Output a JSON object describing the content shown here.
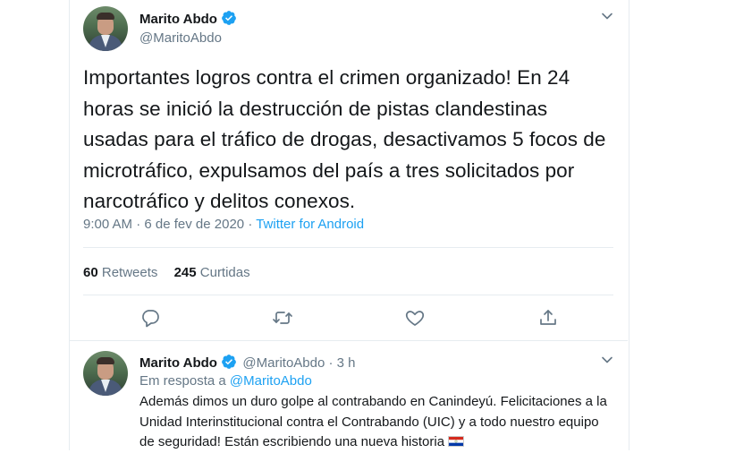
{
  "tweet": {
    "author_name": "Marito Abdo",
    "author_handle": "@MaritoAbdo",
    "text": "Importantes logros contra el crimen organizado! En 24 horas se inició la destrucción de pistas clandestinas usadas para el tráfico de drogas, desactivamos 5 focos de microtráfico, expulsamos del país a tres solicitados por narcotráfico y delitos conexos.",
    "time": "9:00 AM",
    "date": "6 de fev de 2020",
    "separator": " · ",
    "source": "Twitter for Android",
    "retweets_count": "60",
    "retweets_label": "Retweets",
    "likes_count": "245",
    "likes_label": "Curtidas"
  },
  "reply": {
    "author_name": "Marito Abdo",
    "author_handle": "@MaritoAbdo",
    "time_ago": "3 h",
    "in_reply_label": "Em resposta a",
    "in_reply_mention": "@MaritoAbdo",
    "text": "Además dimos un duro golpe al contrabando en Canindeyú. Felicitaciones a la Unidad Interinstitucional contra el Contrabando (UIC) y a todo nuestro equipo de seguridad! Están escribiendo una nueva historia"
  },
  "icons": {
    "verified": "verified-badge-icon",
    "caret": "chevron-down-icon",
    "reply": "reply-icon",
    "retweet": "retweet-icon",
    "like": "heart-icon",
    "share": "share-icon",
    "flag": "paraguay-flag-icon"
  },
  "colors": {
    "accent": "#1da1f2",
    "secondary_text": "#657786",
    "primary_text": "#14171a",
    "border": "#e6ecf0"
  }
}
